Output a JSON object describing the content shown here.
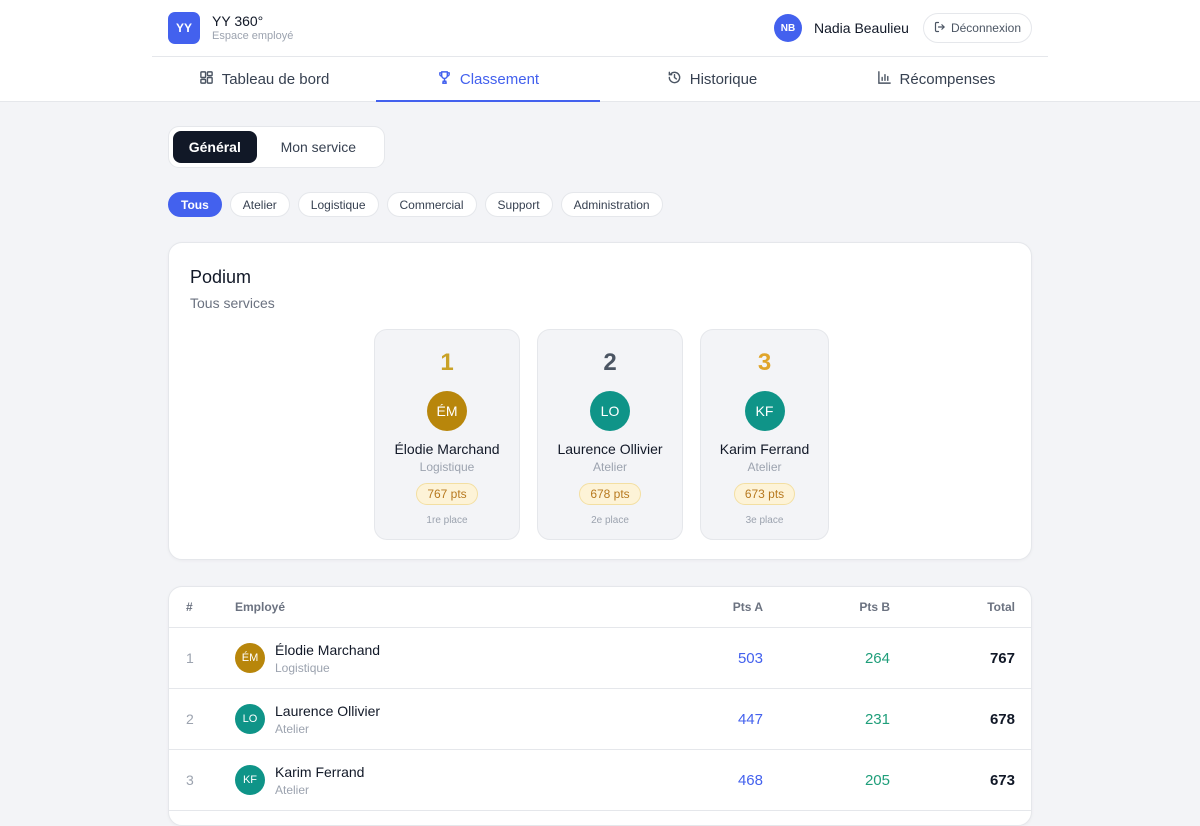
{
  "app": {
    "logo_initials": "YY",
    "name": "YY 360°",
    "subtitle": "Espace employé"
  },
  "user": {
    "initials": "NB",
    "name": "Nadia Beaulieu",
    "logout_label": "Déconnexion"
  },
  "nav": {
    "tabs": [
      {
        "label": "Tableau de bord",
        "icon": "dashboard-icon"
      },
      {
        "label": "Classement",
        "icon": "trophy-icon",
        "active": true
      },
      {
        "label": "Historique",
        "icon": "history-icon"
      },
      {
        "label": "Récompenses",
        "icon": "chart-bar-icon"
      }
    ]
  },
  "scope": {
    "options": [
      "Général",
      "Mon service"
    ],
    "selected": "Général"
  },
  "filters": {
    "items": [
      "Tous",
      "Atelier",
      "Logistique",
      "Commercial",
      "Support",
      "Administration"
    ],
    "selected": "Tous"
  },
  "podium": {
    "title": "Podium",
    "subtitle": "Tous services",
    "entries": [
      {
        "rank": "1",
        "initials": "ÉM",
        "name": "Élodie Marchand",
        "department": "Logistique",
        "points": "767 pts",
        "place": "1re place",
        "rank_color": "#c9a227",
        "avatar_color": "#b8860b"
      },
      {
        "rank": "2",
        "initials": "LO",
        "name": "Laurence Ollivier",
        "department": "Atelier",
        "points": "678 pts",
        "place": "2e place",
        "rank_color": "#4b5563",
        "avatar_color": "#0f9488"
      },
      {
        "rank": "3",
        "initials": "KF",
        "name": "Karim Ferrand",
        "department": "Atelier",
        "points": "673 pts",
        "place": "3e place",
        "rank_color": "#e0a52b",
        "avatar_color": "#0f9488"
      }
    ]
  },
  "table": {
    "headers": {
      "rank": "#",
      "employee": "Employé",
      "pts_a": "Pts A",
      "pts_b": "Pts B",
      "total": "Total"
    },
    "rows": [
      {
        "rank": "1",
        "initials": "ÉM",
        "name": "Élodie Marchand",
        "department": "Logistique",
        "pts_a": "503",
        "pts_b": "264",
        "total": "767",
        "avatar_color": "#b8860b"
      },
      {
        "rank": "2",
        "initials": "LO",
        "name": "Laurence Ollivier",
        "department": "Atelier",
        "pts_a": "447",
        "pts_b": "231",
        "total": "678",
        "avatar_color": "#0f9488"
      },
      {
        "rank": "3",
        "initials": "KF",
        "name": "Karim Ferrand",
        "department": "Atelier",
        "pts_a": "468",
        "pts_b": "205",
        "total": "673",
        "avatar_color": "#0f9488"
      }
    ]
  },
  "colors": {
    "accent": "#4361ee",
    "gold": "#c9a227",
    "teal": "#0f9488"
  }
}
